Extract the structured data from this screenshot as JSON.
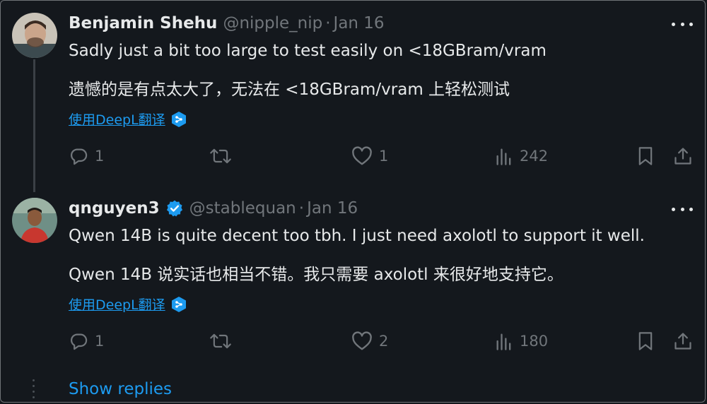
{
  "tweets": [
    {
      "name": "Benjamin Shehu",
      "handle": "@nipple_nip",
      "separator": "·",
      "date": "Jan 16",
      "verified": false,
      "text_en": "Sadly just a bit too large to test easily on <18GBram/vram",
      "text_zh": "遗憾的是有点太大了，无法在 <18GBram/vram 上轻松测试",
      "translate_label": "使用DeepL翻译",
      "replies": "1",
      "retweets": "",
      "likes": "1",
      "views": "242"
    },
    {
      "name": "qnguyen3",
      "handle": "@stablequan",
      "separator": "·",
      "date": "Jan 16",
      "verified": true,
      "text_en": "Qwen 14B is quite decent too tbh. I just need axolotl to support it well.",
      "text_zh": "Qwen 14B 说实话也相当不错。我只需要 axolotl 来很好地支持它。",
      "translate_label": "使用DeepL翻译",
      "replies": "1",
      "retweets": "",
      "likes": "2",
      "views": "180"
    }
  ],
  "show_replies_label": "Show replies",
  "colors": {
    "background": "#14181d",
    "text": "#e7e9ea",
    "muted": "#71767b",
    "accent": "#1d9bf0"
  },
  "icons": {
    "reply": "reply-icon",
    "retweet": "retweet-icon",
    "like": "heart-icon",
    "views": "views-icon",
    "bookmark": "bookmark-icon",
    "share": "share-icon",
    "more": "more-icon",
    "verified": "verified-badge-icon",
    "deepl": "deepl-icon"
  }
}
